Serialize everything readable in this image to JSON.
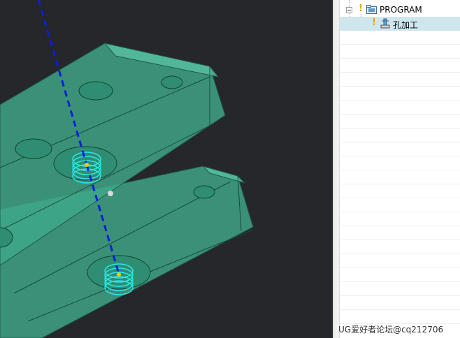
{
  "navigator": {
    "items": [
      {
        "label": "PROGRAM",
        "icon": "program-folder-icon",
        "status": "warning-icon",
        "expanded": true
      },
      {
        "label": "孔加工",
        "icon": "drilling-operation-icon",
        "status": "warning-icon",
        "selected": true
      }
    ]
  },
  "watermark": "UG爱好者论坛@cq212706",
  "colors": {
    "viewport_bg": "#25272b",
    "part_fill": "#3fa88a",
    "tool_path": "#0a1fd6",
    "thread": "#2ee6e6",
    "selected_row": "#cfe6ee",
    "warning": "#e8a400"
  }
}
